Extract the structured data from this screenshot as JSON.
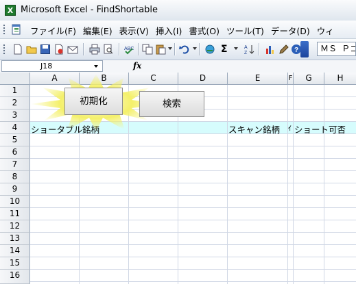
{
  "window": {
    "title": "Microsoft Excel - FindShortable"
  },
  "menu": {
    "items": [
      "ファイル(F)",
      "編集(E)",
      "表示(V)",
      "挿入(I)",
      "書式(O)",
      "ツール(T)",
      "データ(D)",
      "ウィ"
    ]
  },
  "toolbar": {
    "font_name": "ＭＳ Ｐゴシ",
    "sum_label": "Σ"
  },
  "formula_bar": {
    "cell_ref": "J18",
    "fx_label": "fx"
  },
  "grid": {
    "columns": [
      "A",
      "B",
      "C",
      "D",
      "E",
      "F",
      "G",
      "H"
    ],
    "rows": [
      "1",
      "2",
      "3",
      "4",
      "5",
      "6",
      "7",
      "8",
      "9",
      "10",
      "11",
      "12",
      "13",
      "14",
      "15",
      "16"
    ],
    "a4": "ショータブル銘柄",
    "e4": "スキャン銘柄",
    "f4": "ｲ",
    "g4": "ショート可否"
  },
  "buttons": {
    "init": "初期化",
    "search": "検索"
  },
  "colors": {
    "row4_fill": "#d6fcfd",
    "burst": "#f4f06a"
  }
}
